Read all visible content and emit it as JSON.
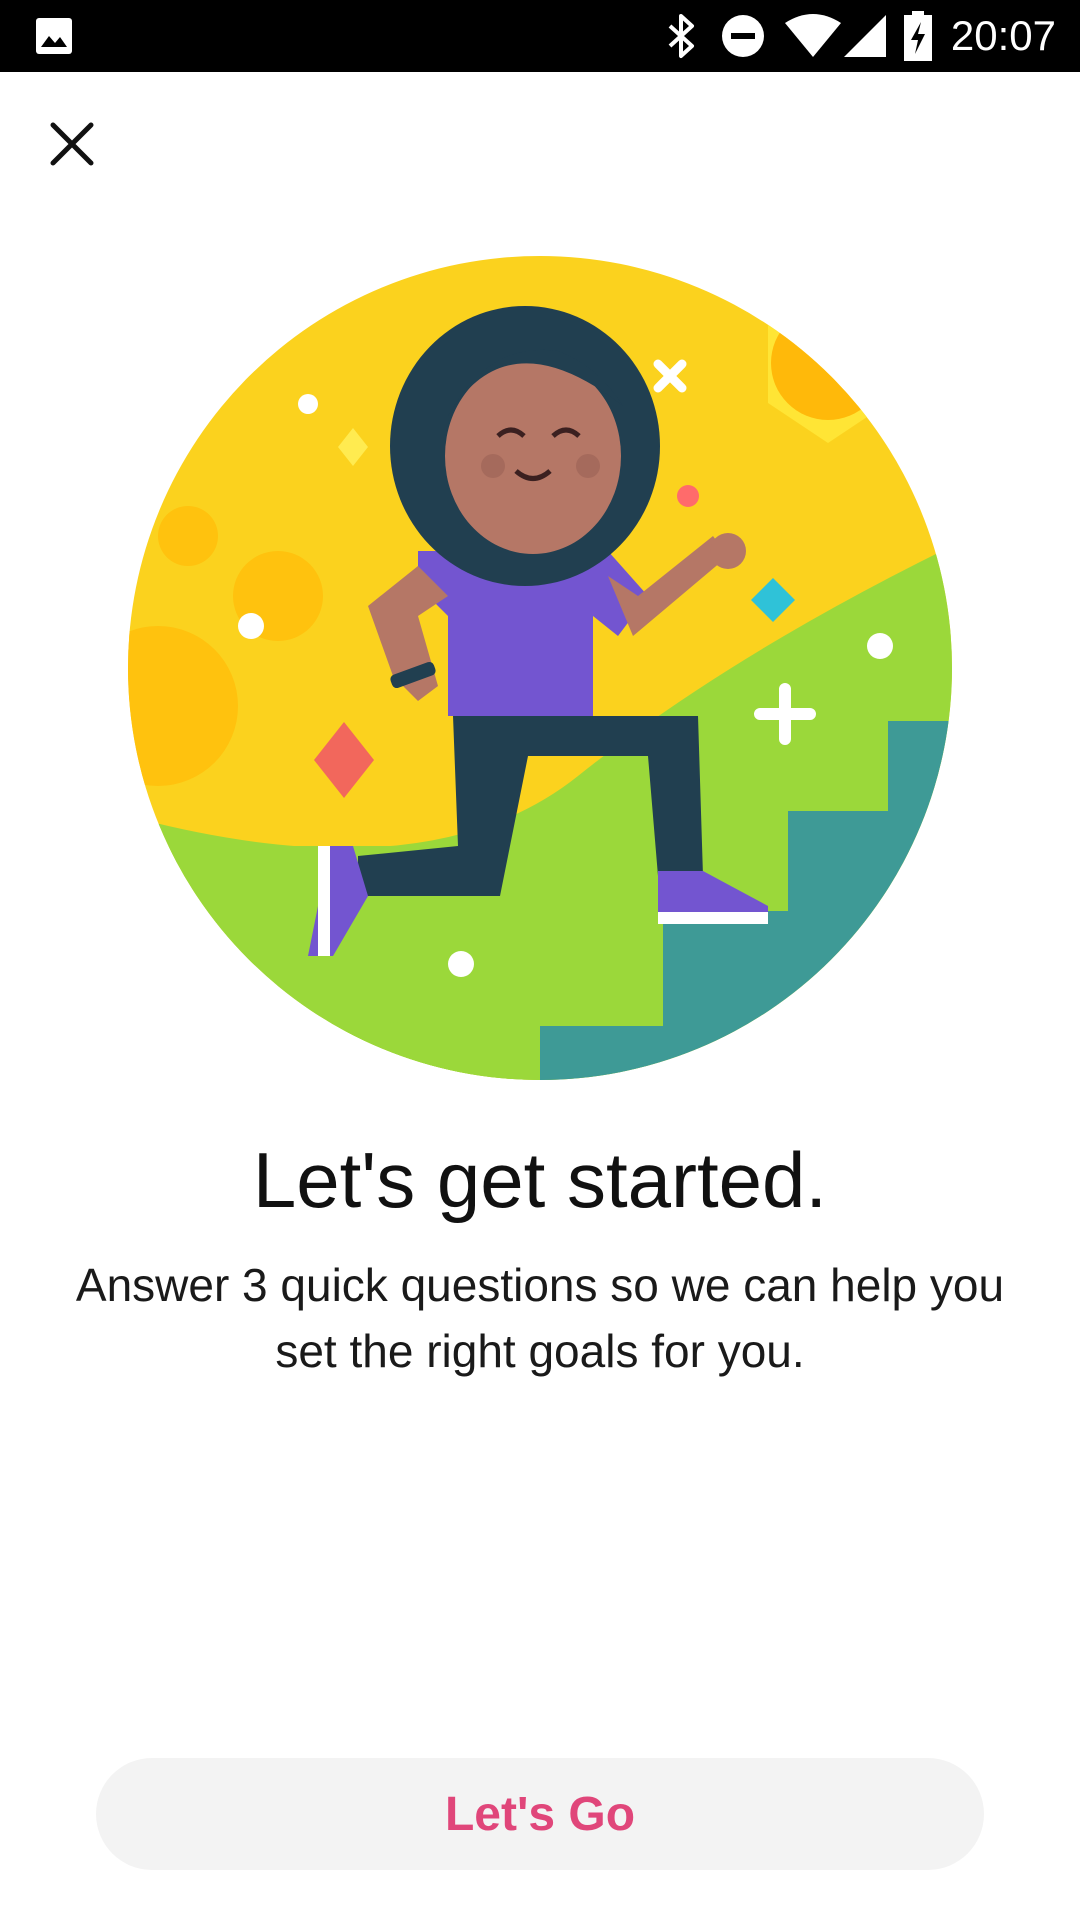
{
  "status_bar": {
    "time": "20:07",
    "icons": [
      "gallery-notification-icon",
      "bluetooth-icon",
      "do-not-disturb-icon",
      "wifi-icon",
      "cell-signal-icon",
      "battery-charging-icon"
    ]
  },
  "toolbar": {
    "close_icon": "close-icon"
  },
  "hero": {
    "illustration": "person-climbing-stairs-illustration",
    "colors": {
      "sky": "#fbd21e",
      "grass": "#9bd83a",
      "stairs": "#3e9a96",
      "shirt": "#7355d0",
      "sun": "#ffb90a"
    }
  },
  "content": {
    "title": "Let's get started.",
    "subtitle": "Answer 3 quick questions so we can help you set the right goals for you."
  },
  "cta": {
    "label": "Let's Go",
    "color": "#e0467a"
  }
}
